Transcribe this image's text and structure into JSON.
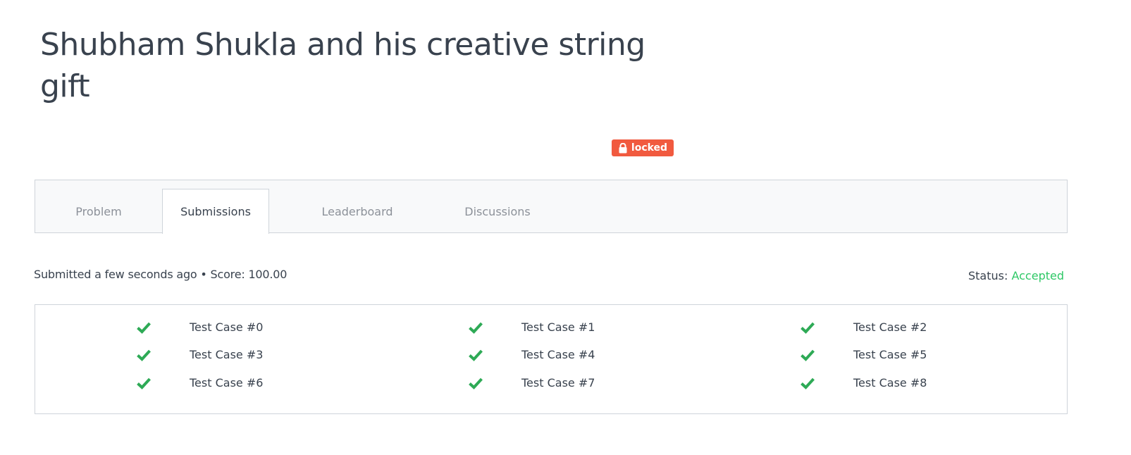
{
  "problem": {
    "title": "Shubham Shukla and his creative string gift",
    "badge": "locked",
    "badge_icon": "lock-icon",
    "badge_color": "#f15a3f"
  },
  "tabs": [
    {
      "label": "Problem",
      "active": false
    },
    {
      "label": "Submissions",
      "active": true
    },
    {
      "label": "Leaderboard",
      "active": false
    },
    {
      "label": "Discussions",
      "active": false
    }
  ],
  "submission": {
    "submitted_text": "Submitted a few seconds ago",
    "separator": "•",
    "score_label": "Score:",
    "score_value": "100.00",
    "status_label": "Status:",
    "status_value": "Accepted",
    "status_color": "#2ec866"
  },
  "test_cases": [
    {
      "label": "Test Case #0",
      "result": "pass",
      "icon": "check-icon"
    },
    {
      "label": "Test Case #1",
      "result": "pass",
      "icon": "check-icon"
    },
    {
      "label": "Test Case #2",
      "result": "pass",
      "icon": "check-icon"
    },
    {
      "label": "Test Case #3",
      "result": "pass",
      "icon": "check-icon"
    },
    {
      "label": "Test Case #4",
      "result": "pass",
      "icon": "check-icon"
    },
    {
      "label": "Test Case #5",
      "result": "pass",
      "icon": "check-icon"
    },
    {
      "label": "Test Case #6",
      "result": "pass",
      "icon": "check-icon"
    },
    {
      "label": "Test Case #7",
      "result": "pass",
      "icon": "check-icon"
    },
    {
      "label": "Test Case #8",
      "result": "pass",
      "icon": "check-icon"
    }
  ],
  "colors": {
    "check": "#2eaa56",
    "text": "#39424e",
    "muted": "#8c9199"
  }
}
